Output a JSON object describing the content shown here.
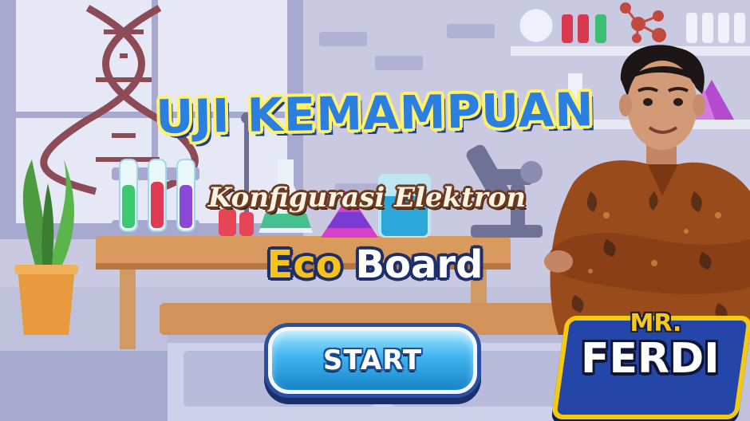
{
  "game": {
    "title": "UJI KEMAMPUAN",
    "subtitle": "Konfigurasi Elektron",
    "brand": {
      "part1": "Eco",
      "part2": "Board"
    },
    "start_label": "START",
    "host": {
      "prefix": "MR.",
      "name": "FERDI"
    }
  },
  "colors": {
    "title_fill": "#2a7fe0",
    "title_outline": "#fff16a",
    "start_button": "#3fb4ee",
    "badge_bg": "#2446a8",
    "badge_border": "#f4c90f"
  }
}
